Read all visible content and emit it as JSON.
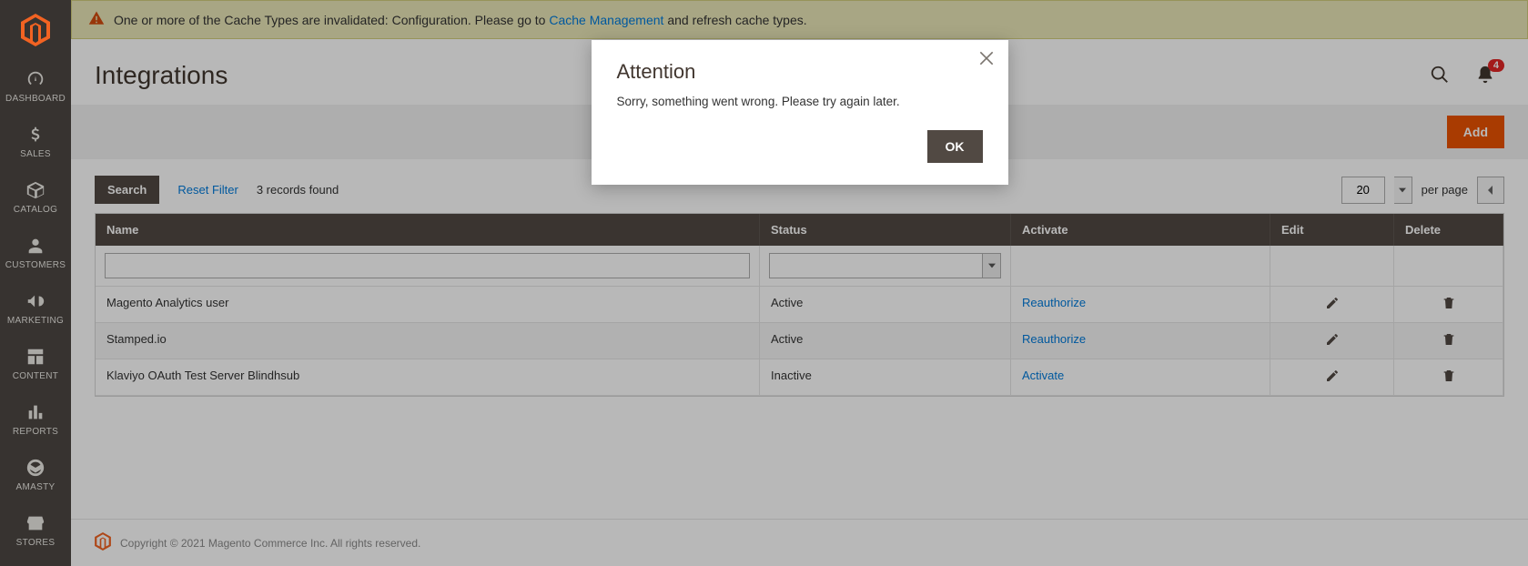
{
  "sidebar": {
    "items": [
      {
        "label": "DASHBOARD",
        "icon": "gauge"
      },
      {
        "label": "SALES",
        "icon": "dollar"
      },
      {
        "label": "CATALOG",
        "icon": "box"
      },
      {
        "label": "CUSTOMERS",
        "icon": "person"
      },
      {
        "label": "MARKETING",
        "icon": "megaphone"
      },
      {
        "label": "CONTENT",
        "icon": "layout"
      },
      {
        "label": "REPORTS",
        "icon": "bars"
      },
      {
        "label": "AMASTY",
        "icon": "amasty"
      },
      {
        "label": "STORES",
        "icon": "storefront"
      }
    ]
  },
  "notice": {
    "text_before": "One or more of the Cache Types are invalidated: Configuration. Please go to ",
    "link_text": "Cache Management",
    "text_after": " and refresh cache types."
  },
  "header": {
    "title": "Integrations",
    "bell_count": "4"
  },
  "action_bar": {
    "add_label": "Add"
  },
  "toolbar": {
    "search_label": "Search",
    "reset_label": "Reset Filter",
    "records_text": "3 records found",
    "per_page_value": "20",
    "per_page_label": "per page"
  },
  "table": {
    "columns": {
      "name": "Name",
      "status": "Status",
      "activate": "Activate",
      "edit": "Edit",
      "delete": "Delete"
    },
    "filter_name": "",
    "filter_status": "",
    "rows": [
      {
        "name": "Magento Analytics user",
        "status": "Active",
        "activate": "Reauthorize"
      },
      {
        "name": "Stamped.io",
        "status": "Active",
        "activate": "Reauthorize"
      },
      {
        "name": "Klaviyo OAuth Test Server Blindhsub",
        "status": "Inactive",
        "activate": "Activate"
      }
    ]
  },
  "footer": {
    "text": "Copyright © 2021 Magento Commerce Inc. All rights reserved."
  },
  "modal": {
    "title": "Attention",
    "body": "Sorry, something went wrong. Please try again later.",
    "ok_label": "OK"
  }
}
